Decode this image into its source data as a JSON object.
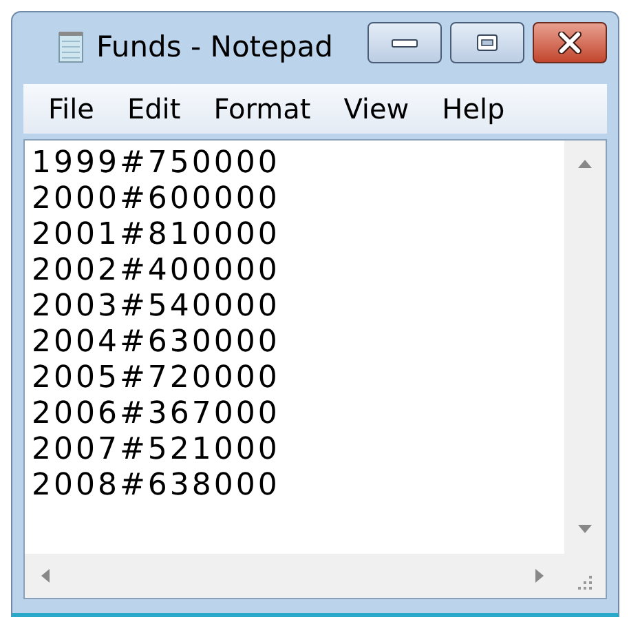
{
  "window": {
    "title": "Funds - Notepad"
  },
  "menu": [
    "File",
    "Edit",
    "Format",
    "View",
    "Help"
  ],
  "editor": {
    "lines": [
      "1999#750000",
      "2000#600000",
      "2001#810000",
      "2002#400000",
      "2003#540000",
      "2004#630000",
      "2005#720000",
      "2006#367000",
      "2007#521000",
      "2008#638000"
    ]
  }
}
